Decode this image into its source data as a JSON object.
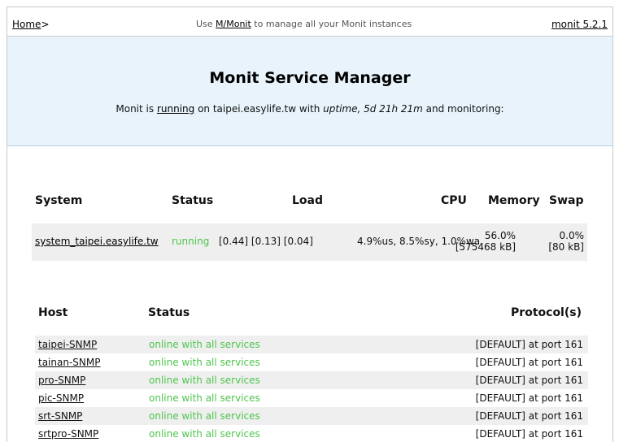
{
  "topbar": {
    "home": "Home",
    "home_sep": ">",
    "mmonit_prefix": "Use ",
    "mmonit_link": "M/Monit",
    "mmonit_suffix": " to manage all your Monit instances",
    "version": "monit 5.2.1"
  },
  "hero": {
    "title": "Monit Service Manager",
    "sub_prefix": "Monit is ",
    "sub_link": "running",
    "sub_mid": " on taipei.easylife.tw with ",
    "sub_uptime": "uptime, 5d 21h 21m",
    "sub_suffix": "  and monitoring:"
  },
  "system": {
    "headers": {
      "system": "System",
      "status": "Status",
      "load": "Load",
      "cpu": "CPU",
      "memory": "Memory",
      "swap": "Swap"
    },
    "row": {
      "name": "system_taipei.easylife.tw",
      "status": "running",
      "load": "[0.44] [0.13] [0.04]",
      "cpu": "4.9%us, 8.5%sy, 1.0%wa",
      "memory_pct": "56.0%",
      "memory_kb": "[575468 kB]",
      "swap_pct": "0.0%",
      "swap_kb": "[80 kB]"
    }
  },
  "hosts": {
    "headers": {
      "host": "Host",
      "status": "Status",
      "protocol": "Protocol(s)"
    },
    "rows": [
      {
        "host": "taipei-SNMP",
        "status": "online with all services",
        "protocol": "[DEFAULT] at port 161"
      },
      {
        "host": "tainan-SNMP",
        "status": "online with all services",
        "protocol": "[DEFAULT] at port 161"
      },
      {
        "host": "pro-SNMP",
        "status": "online with all services",
        "protocol": "[DEFAULT] at port 161"
      },
      {
        "host": "pic-SNMP",
        "status": "online with all services",
        "protocol": "[DEFAULT] at port 161"
      },
      {
        "host": "srt-SNMP",
        "status": "online with all services",
        "protocol": "[DEFAULT] at port 161"
      },
      {
        "host": "srtpro-SNMP",
        "status": "online with all services",
        "protocol": "[DEFAULT] at port 161"
      }
    ]
  },
  "colors": {
    "status_green": "#4ec54e",
    "hero_bg": "#e8f3fb",
    "row_alt": "#efefef"
  }
}
